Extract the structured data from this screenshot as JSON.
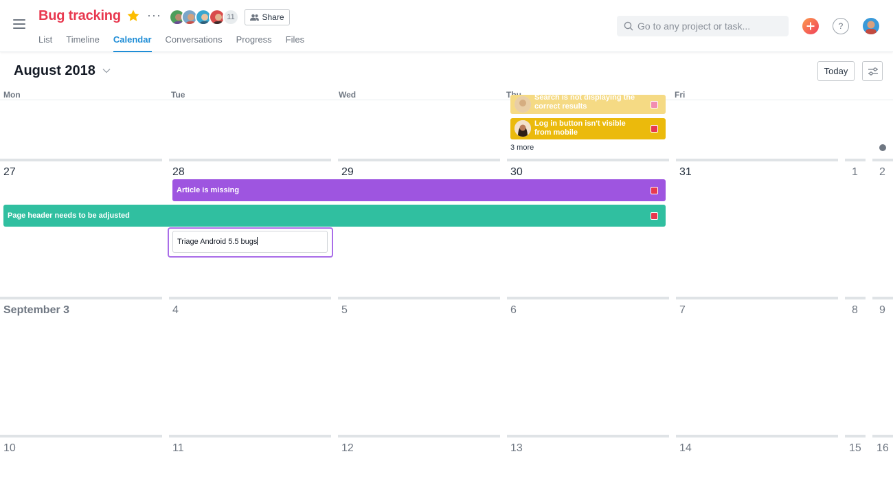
{
  "header": {
    "project_title": "Bug tracking",
    "member_count": "11",
    "share_label": "Share",
    "tabs": [
      "List",
      "Timeline",
      "Calendar",
      "Conversations",
      "Progress",
      "Files"
    ],
    "active_tab": "Calendar",
    "search_placeholder": "Go to any project or task...",
    "help_label": "?",
    "accent_color": "#e8384f"
  },
  "calendar": {
    "month_label": "August 2018",
    "today_label": "Today",
    "weekdays": [
      "Mon",
      "Tue",
      "Wed",
      "Thu",
      "Fri"
    ],
    "more_label": "3 more",
    "weeks": [
      {
        "days": [
          "27",
          "28",
          "29",
          "30",
          "31",
          "1",
          "2"
        ]
      },
      {
        "days": [
          "September 3",
          "4",
          "5",
          "6",
          "7",
          "8",
          "9"
        ]
      },
      {
        "days": [
          "10",
          "11",
          "12",
          "13",
          "14",
          "15",
          "16"
        ]
      }
    ]
  },
  "events": {
    "thu_partial": "Search is not displaying the correct results",
    "thu_login": "Log in button isn't visible from mobile",
    "article": "Article is missing",
    "page_header": "Page header needs to be adjusted",
    "new_task_value": "Triage Android 5.5 bugs",
    "colors": {
      "purple": "#9e55e0",
      "teal": "#30bfa0",
      "gold": "#ebba0c",
      "pale_gold": "#f5da84"
    }
  }
}
